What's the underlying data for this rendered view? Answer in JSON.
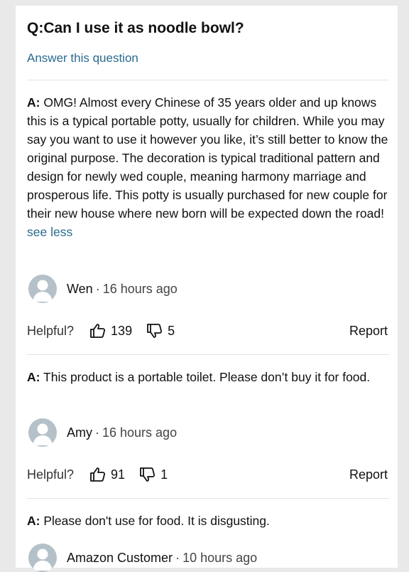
{
  "question": {
    "title": "Q:Can I use it as noodle bowl?",
    "answer_link": "Answer this question"
  },
  "answers": [
    {
      "prefix": "A:",
      "text": "OMG! Almost every Chinese of 35 years older and up knows this is a typical portable potty, usually for children. While you may say you want to use it however you like, it’s still better to know the original purpose. The decoration is typical traditional pattern and design for newly wed couple, meaning harmony marriage and prosperous life. This potty is usually purchased for new couple for their new house where new born will be expected down the road!",
      "see_less": "see less",
      "author": "Wen",
      "separator": "·",
      "time": "16 hours ago",
      "helpful_label": "Helpful?",
      "upvotes": "139",
      "downvotes": "5",
      "report": "Report"
    },
    {
      "prefix": "A:",
      "text": "This product is a portable toilet. Please don’t buy it for food.",
      "author": "Amy",
      "separator": "·",
      "time": "16 hours ago",
      "helpful_label": "Helpful?",
      "upvotes": "91",
      "downvotes": "1",
      "report": "Report"
    },
    {
      "prefix": "A:",
      "text": "Please don't use for food. It is disgusting.",
      "author": "Amazon Customer",
      "separator": "·",
      "time": "10 hours ago"
    }
  ],
  "icons": {
    "avatar": "user-silhouette-icon",
    "upvote": "thumbs-up-icon",
    "downvote": "thumbs-down-icon"
  },
  "colors": {
    "link": "#2a6b8f",
    "avatar_bg": "#b4c1c8",
    "page_bg": "#e9e9e9"
  }
}
